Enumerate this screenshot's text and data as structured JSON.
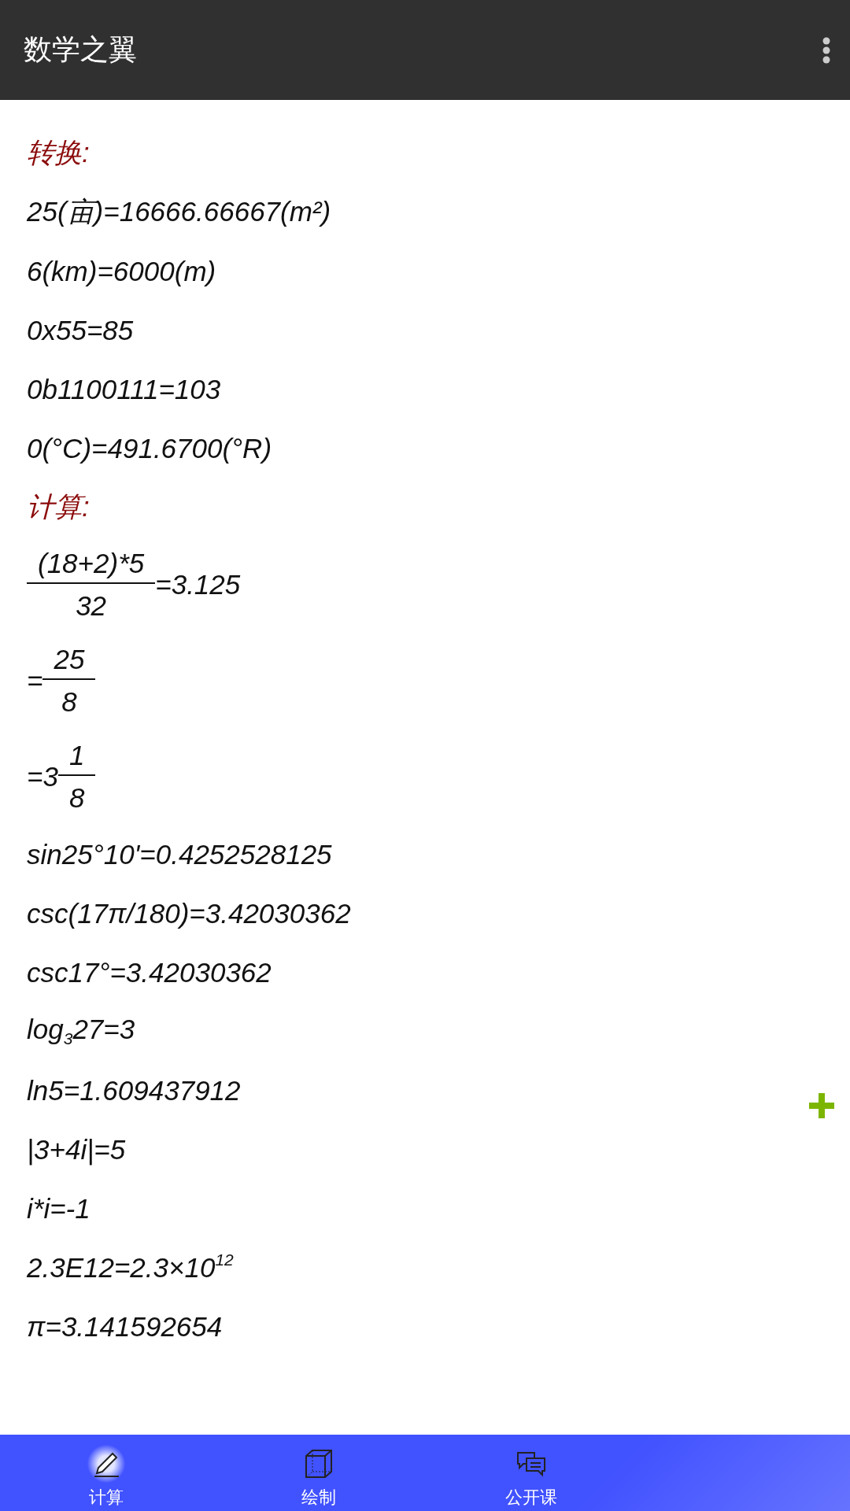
{
  "app_bar": {
    "title": "数学之翼"
  },
  "lines": [
    {
      "kind": "heading",
      "text": "转换:"
    },
    {
      "kind": "text",
      "text": "25(亩)=16666.66667(m²)"
    },
    {
      "kind": "text",
      "text": "6(km)=6000(m)"
    },
    {
      "kind": "text",
      "text": "0x55=85"
    },
    {
      "kind": "text",
      "text": "0b1100111=103"
    },
    {
      "kind": "text",
      "text": "0(°C)=491.6700(°R)"
    },
    {
      "kind": "heading",
      "text": "计算:"
    },
    {
      "kind": "fraction",
      "numerator": "(18+2)*5",
      "denominator": "32",
      "suffix": "=3.125"
    },
    {
      "kind": "fraction",
      "prefix": "=",
      "numerator": "25",
      "denominator": "8"
    },
    {
      "kind": "fraction",
      "prefix": "=3",
      "numerator": "1",
      "denominator": "8"
    },
    {
      "kind": "text",
      "text": "sin25°10'=0.4252528125"
    },
    {
      "kind": "text",
      "text": "csc(17π/180)=3.42030362"
    },
    {
      "kind": "text",
      "text": "csc17°=3.42030362"
    },
    {
      "kind": "text",
      "text": "log$_{3}$27=3"
    },
    {
      "kind": "text",
      "text": "ln5=1.609437912"
    },
    {
      "kind": "text",
      "text": "|3+4i|=5"
    },
    {
      "kind": "text",
      "text": "i*i=-1"
    },
    {
      "kind": "text",
      "text": "2.3E12=2.3×10$^{12}$"
    },
    {
      "kind": "text",
      "text": "π=3.141592654"
    }
  ],
  "tabs": [
    {
      "label": "计算",
      "kind": "pencil",
      "selected": true
    },
    {
      "label": "绘制",
      "kind": "cube",
      "selected": false
    },
    {
      "label": "公开课",
      "kind": "chat",
      "selected": false
    }
  ]
}
